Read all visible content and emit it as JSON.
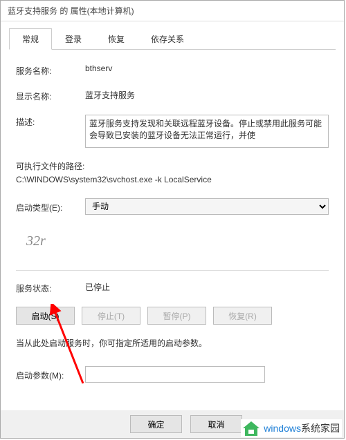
{
  "window": {
    "title": "蓝牙支持服务 的 属性(本地计算机)"
  },
  "tabs": {
    "general": "常规",
    "logon": "登录",
    "recovery": "恢复",
    "dependencies": "依存关系"
  },
  "fields": {
    "service_name_label": "服务名称:",
    "service_name_value": "bthserv",
    "display_name_label": "显示名称:",
    "display_name_value": "蓝牙支持服务",
    "description_label": "描述:",
    "description_value": "蓝牙服务支持发现和关联远程蓝牙设备。停止或禁用此服务可能会导致已安装的蓝牙设备无法正常运行，并使",
    "path_label": "可执行文件的路径:",
    "path_value": "C:\\WINDOWS\\system32\\svchost.exe -k LocalService",
    "startup_type_label": "启动类型(E):",
    "startup_type_value": "手动",
    "service_status_label": "服务状态:",
    "service_status_value": "已停止"
  },
  "buttons": {
    "start": "启动(S)",
    "stop": "停止(T)",
    "pause": "暂停(P)",
    "resume": "恢复(R)",
    "ok": "确定",
    "cancel": "取消"
  },
  "hint": "当从此处启动服务时，你可指定所适用的启动参数。",
  "param": {
    "label": "启动参数(M):",
    "value": ""
  },
  "watermark": "32r",
  "logo": {
    "text1": "windows",
    "text2": "系统家园"
  }
}
